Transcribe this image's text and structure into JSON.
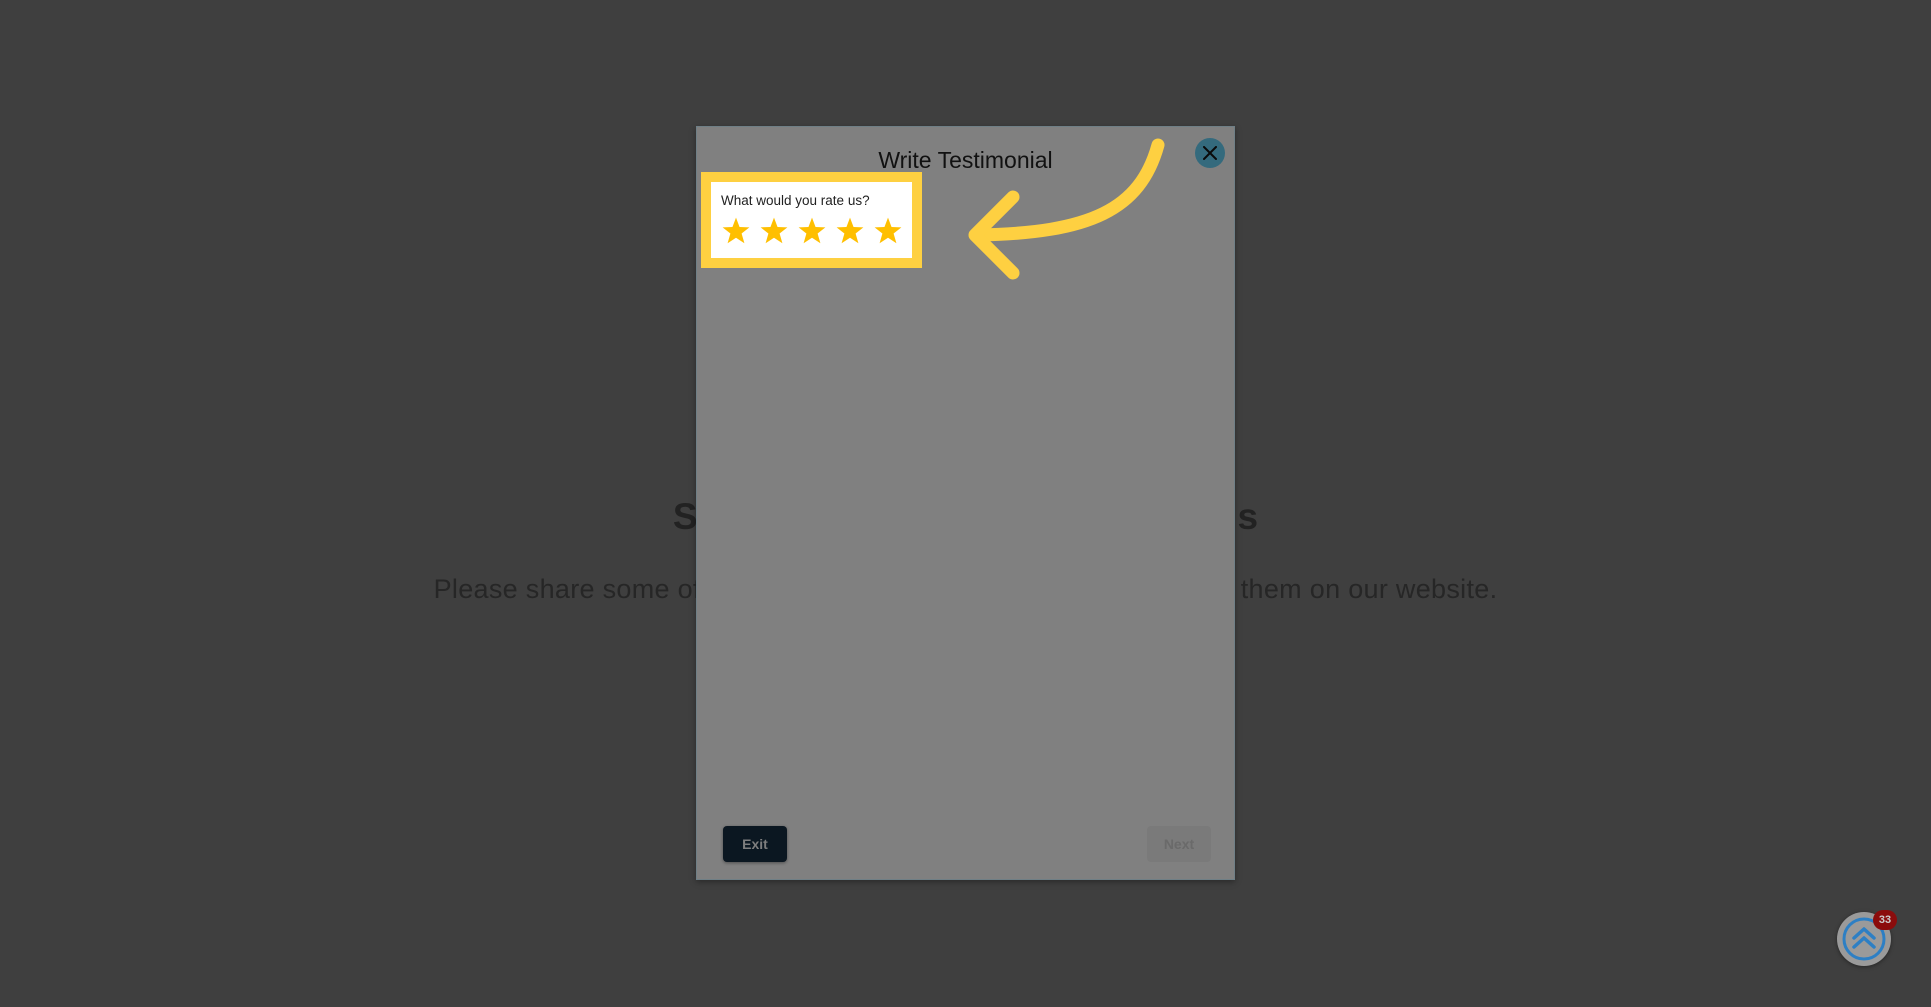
{
  "background": {
    "heading_left": "S",
    "heading_right": "s",
    "subtitle_left": "Please share some of",
    "subtitle_right": "them on our website."
  },
  "modal": {
    "title": "Write Testimonial",
    "close_icon": "close-icon",
    "rating": {
      "question": "What would you rate us?",
      "max_stars": 5,
      "selected_stars": 5
    },
    "exit_label": "Exit",
    "next_label": "Next",
    "next_disabled": true
  },
  "annotation": {
    "highlight_color": "#fed041",
    "arrow_icon": "curved-arrow-icon"
  },
  "floating": {
    "scroll_top_icon": "double-chevron-up-icon",
    "badge_count": "33"
  },
  "colors": {
    "star": "#ffbf00",
    "close_bg": "#346a7d",
    "exit_bg": "#0b1721",
    "badge_bg": "#8b0c0c",
    "scroll_icon": "#2d7fc4"
  }
}
